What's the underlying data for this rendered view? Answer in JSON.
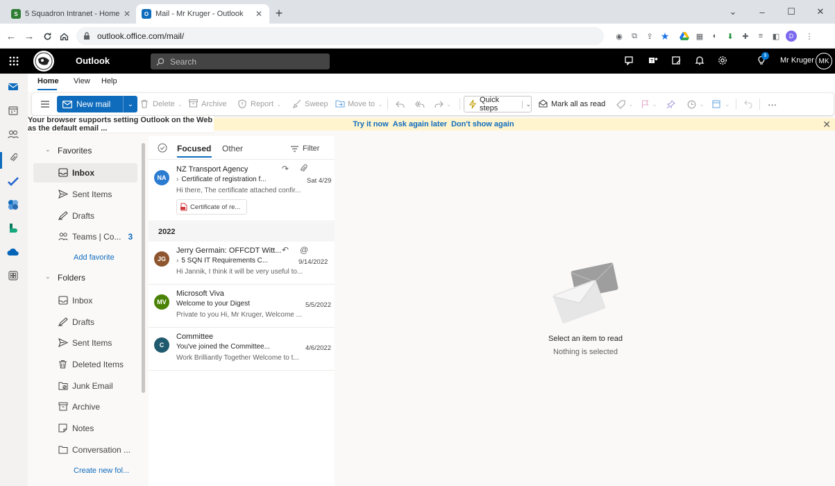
{
  "browser": {
    "tabs": [
      {
        "title": "5 Squadron Intranet - Home",
        "active": false
      },
      {
        "title": "Mail - Mr Kruger - Outlook",
        "active": true
      }
    ],
    "new_tab": "+",
    "url": "outlook.office.com/mail/",
    "profile_initial": "D"
  },
  "header": {
    "app_name": "Outlook",
    "search_placeholder": "Search",
    "user_name": "Mr Kruger",
    "user_initials": "MK",
    "tips_badge": "9"
  },
  "ribbon_tabs": [
    "Home",
    "View",
    "Help"
  ],
  "ribbon": {
    "new_mail": "New mail",
    "delete": "Delete",
    "archive": "Archive",
    "report": "Report",
    "sweep": "Sweep",
    "move_to": "Move to",
    "quick_steps": "Quick steps",
    "mark_all_read": "Mark all as read",
    "more": "···"
  },
  "infobar": {
    "message": "Your browser supports setting Outlook on the Web as the default email ...",
    "try_it": "Try it now",
    "ask_later": "Ask again later",
    "dont_show": "Don't show again"
  },
  "folders": {
    "favorites_label": "Favorites",
    "favorites": [
      {
        "label": "Inbox",
        "icon": "inbox-icon",
        "selected": true
      },
      {
        "label": "Sent Items",
        "icon": "send-icon"
      },
      {
        "label": "Drafts",
        "icon": "drafts-icon"
      },
      {
        "label": "Teams | Co...",
        "icon": "group-icon",
        "count": "3"
      }
    ],
    "add_favorite": "Add favorite",
    "folders_label": "Folders",
    "list": [
      {
        "label": "Inbox",
        "icon": "inbox-icon"
      },
      {
        "label": "Drafts",
        "icon": "drafts-icon"
      },
      {
        "label": "Sent Items",
        "icon": "send-icon"
      },
      {
        "label": "Deleted Items",
        "icon": "trash-icon"
      },
      {
        "label": "Junk Email",
        "icon": "junk-icon"
      },
      {
        "label": "Archive",
        "icon": "archive-icon"
      },
      {
        "label": "Notes",
        "icon": "notes-icon"
      },
      {
        "label": "Conversation ...",
        "icon": "folder-icon"
      }
    ],
    "create_new": "Create new fol..."
  },
  "message_list": {
    "tab_focused": "Focused",
    "tab_other": "Other",
    "filter": "Filter",
    "group_label": "2022",
    "messages": [
      {
        "initials": "NA",
        "avatar_color": "#2b7bd0",
        "from": "NZ Transport Agency",
        "subject": "Certificate of registration f...",
        "date": "Sat 4/29",
        "preview": "Hi there, The certificate attached confir...",
        "attachment": "Certificate of re..."
      },
      {
        "initials": "JG",
        "avatar_color": "#8e562e",
        "from": "Jerry Germain: OFFCDT Witt...",
        "subject": "5 SQN IT Requirements C...",
        "date": "9/14/2022",
        "preview": "Hi Jannik, I think it will be very useful to..."
      },
      {
        "initials": "MV",
        "avatar_color": "#498205",
        "from": "Microsoft Viva",
        "subject": "Welcome to your Digest",
        "date": "5/5/2022",
        "preview": "Private to you Hi, Mr Kruger, Welcome ..."
      },
      {
        "initials": "C",
        "avatar_color": "#1f5a6e",
        "from": "Committee",
        "subject": "You've joined the Committee...",
        "date": "4/6/2022",
        "preview": "Work Brilliantly Together Welcome to t..."
      }
    ]
  },
  "reading_pane": {
    "title": "Select an item to read",
    "subtitle": "Nothing is selected"
  },
  "colors": {
    "accent": "#0f6cbd",
    "infobar_bg": "#fff4ce",
    "header_bg": "#000000"
  }
}
